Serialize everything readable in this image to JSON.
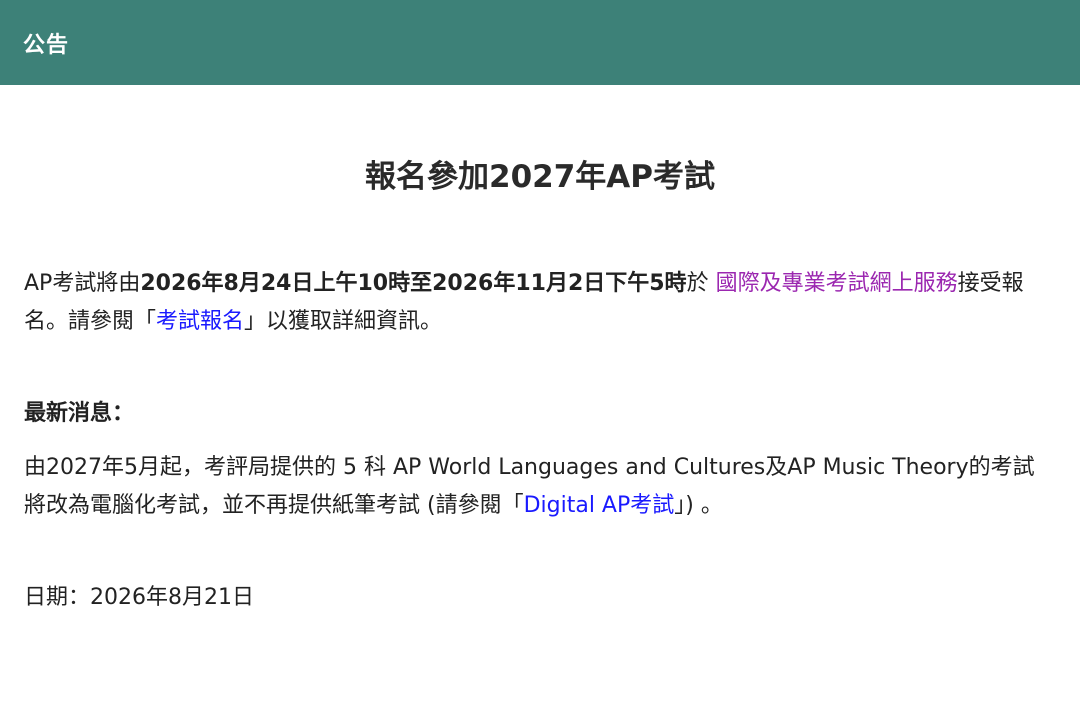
{
  "header": {
    "title": "公告"
  },
  "main": {
    "title": "報名參加2027年AP考試",
    "paragraph1": {
      "text_a": "AP考試將由",
      "bold_period": "2026年8月24日上午10時至2026年11月2日下午5時",
      "text_b": "於 ",
      "link_online_service": "國際及專業考試網上服務",
      "text_c": "接受報名。請參閱「",
      "link_registration": "考試報名",
      "text_d": "」以獲取詳細資訊。"
    },
    "news": {
      "heading": "最新消息：",
      "text_a": "由2027年5月起，考評局提供的 5 科 AP World Languages and Cultures及AP Music Theory的考試將改為電腦化考試，並不再提供紙筆考試 (請參閱「",
      "link_digital_ap": "Digital AP考試",
      "text_b": "」) 。"
    },
    "date": "日期：2026年8月21日"
  },
  "colors": {
    "header_bg": "#3d8178",
    "visited_link": "#9b27b0",
    "link": "#1a1aff"
  }
}
